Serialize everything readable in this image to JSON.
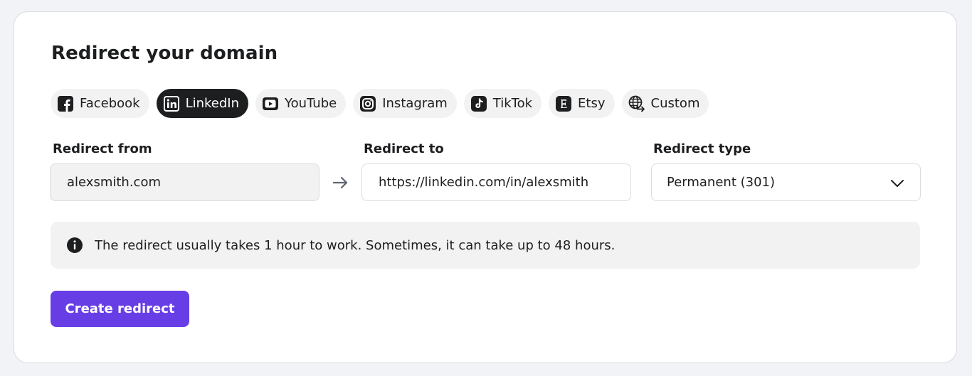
{
  "page": {
    "title": "Redirect your domain"
  },
  "platforms": [
    {
      "label": "Facebook",
      "icon": "facebook-icon",
      "selected": false
    },
    {
      "label": "LinkedIn",
      "icon": "linkedin-icon",
      "selected": true
    },
    {
      "label": "YouTube",
      "icon": "youtube-icon",
      "selected": false
    },
    {
      "label": "Instagram",
      "icon": "instagram-icon",
      "selected": false
    },
    {
      "label": "TikTok",
      "icon": "tiktok-icon",
      "selected": false
    },
    {
      "label": "Etsy",
      "icon": "etsy-icon",
      "selected": false
    },
    {
      "label": "Custom",
      "icon": "globe-redirect-icon",
      "selected": false
    }
  ],
  "form": {
    "redirect_from": {
      "label": "Redirect from",
      "value": "alexsmith.com"
    },
    "redirect_to": {
      "label": "Redirect to",
      "value": "https://linkedin.com/in/alexsmith"
    },
    "redirect_type": {
      "label": "Redirect type",
      "value": "Permanent (301)"
    }
  },
  "notice": {
    "text": "The redirect usually takes 1 hour to work. Sometimes, it can take up to 48 hours.",
    "icon": "info-icon"
  },
  "actions": {
    "create_label": "Create redirect"
  },
  "colors": {
    "primary": "#673de6",
    "selected_chip": "#1d1e20",
    "chip_bg": "#f2f2f2",
    "text": "#1d1e20"
  }
}
